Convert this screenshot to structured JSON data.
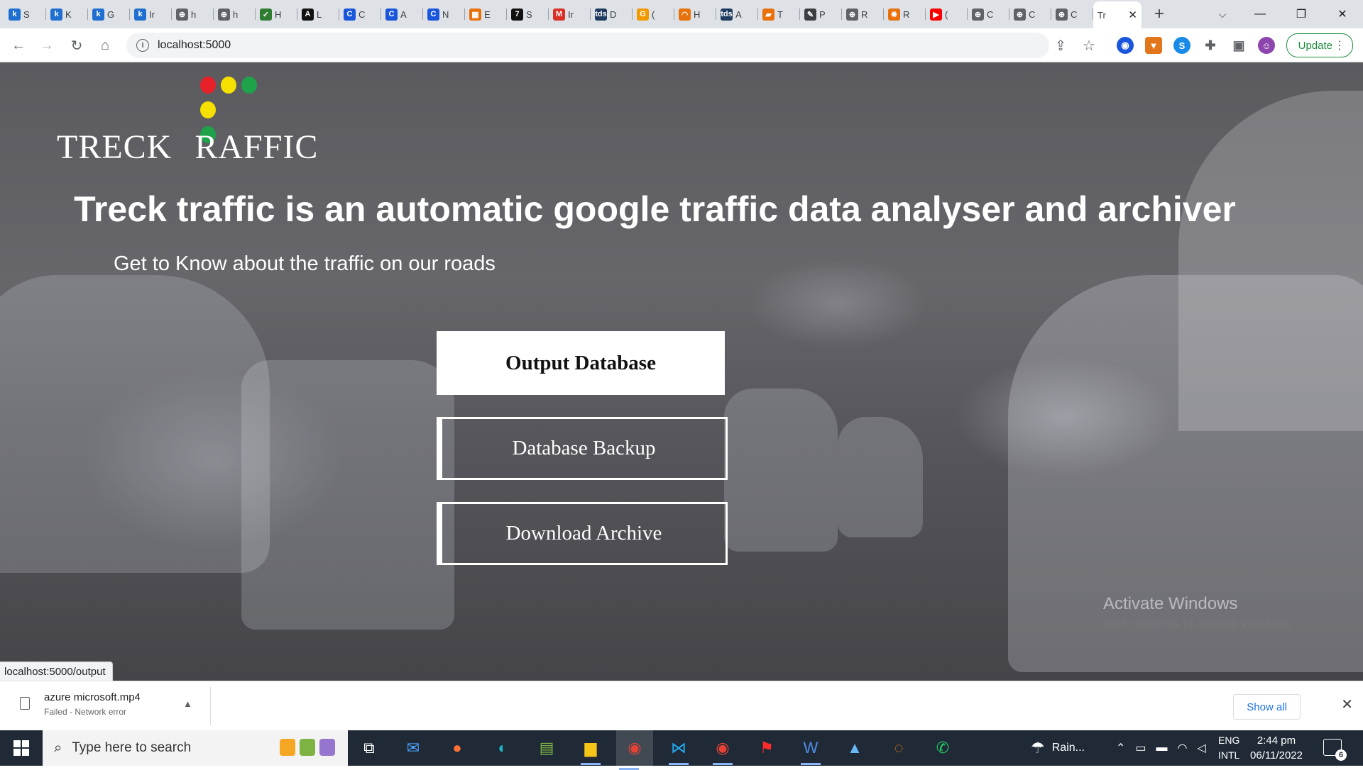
{
  "browser": {
    "tabs": [
      {
        "fav": "k",
        "label": "S",
        "color": "#1f6fd1"
      },
      {
        "fav": "k",
        "label": "K",
        "color": "#1f6fd1"
      },
      {
        "fav": "k",
        "label": "G",
        "color": "#1f6fd1"
      },
      {
        "fav": "k",
        "label": "Ir",
        "color": "#1f6fd1"
      },
      {
        "fav": "⊕",
        "label": "h",
        "color": "#5f6368"
      },
      {
        "fav": "⊕",
        "label": "h",
        "color": "#5f6368"
      },
      {
        "fav": "✓",
        "label": "H",
        "color": "#2e7d32"
      },
      {
        "fav": "A",
        "label": "L",
        "color": "#111111"
      },
      {
        "fav": "C",
        "label": "C",
        "color": "#1a56db"
      },
      {
        "fav": "C",
        "label": "A",
        "color": "#1a56db"
      },
      {
        "fav": "C",
        "label": "N",
        "color": "#1a56db"
      },
      {
        "fav": "▦",
        "label": "E",
        "color": "#e8710a"
      },
      {
        "fav": "7",
        "label": "S",
        "color": "#111111"
      },
      {
        "fav": "M",
        "label": "Ir",
        "color": "#d93025"
      },
      {
        "fav": "tds",
        "label": "D",
        "color": "#1e3a5f"
      },
      {
        "fav": "G",
        "label": "(",
        "color": "#f29900"
      },
      {
        "fav": "◠",
        "label": "H",
        "color": "#e8710a"
      },
      {
        "fav": "tds",
        "label": "A",
        "color": "#1e3a5f"
      },
      {
        "fav": "▰",
        "label": "T",
        "color": "#e8710a"
      },
      {
        "fav": "✎",
        "label": "P",
        "color": "#3c4043"
      },
      {
        "fav": "⊕",
        "label": "R",
        "color": "#5f6368"
      },
      {
        "fav": "✹",
        "label": "R",
        "color": "#e8710a"
      },
      {
        "fav": "▶",
        "label": "(",
        "color": "#ff0000"
      },
      {
        "fav": "⊕",
        "label": "C",
        "color": "#5f6368"
      },
      {
        "fav": "⊕",
        "label": "C",
        "color": "#5f6368"
      },
      {
        "fav": "⊕",
        "label": "C",
        "color": "#5f6368"
      }
    ],
    "active_tab_label": "Tr",
    "new_tab": "+",
    "url": "localhost:5000",
    "update_label": "Update",
    "window": {
      "minimize": "—",
      "maximize": "❐",
      "close": "✕"
    }
  },
  "page": {
    "logo": {
      "text_left": "TRECK",
      "text_right": "RAFFIC",
      "lights": {
        "red": "#e8202a",
        "yellow": "#f5e000",
        "green": "#1fa34a"
      }
    },
    "headline": "Treck traffic is an automatic google traffic data analyser and archiver",
    "subline": "Get to Know about the traffic on our roads",
    "buttons": {
      "output": "Output Database",
      "backup": "Database Backup",
      "archive": "Download Archive"
    },
    "status_url": "localhost:5000/output",
    "watermark": {
      "line1": "Activate Windows",
      "line2": "Go to Settings to activate Windows."
    }
  },
  "downloads": {
    "file_name": "azure microsoft.mp4",
    "status": "Failed - Network error",
    "show_all": "Show all"
  },
  "taskbar": {
    "search_placeholder": "Type here to search",
    "weather": "Rain...",
    "lang_top": "ENG",
    "lang_bottom": "INTL",
    "time": "2:44 pm",
    "date": "06/11/2022",
    "notifications": "6"
  }
}
